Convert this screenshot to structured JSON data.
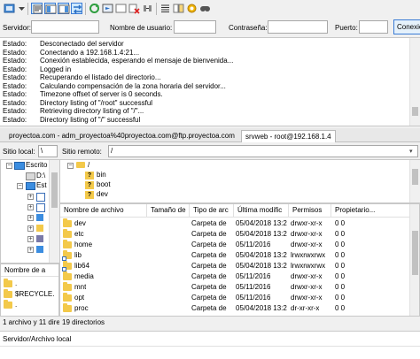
{
  "quickconnect": {
    "host_label": "Servidor:",
    "user_label": "Nombre de usuario:",
    "pass_label": "Contraseña:",
    "port_label": "Puerto:",
    "connect_label": "Conexión rápida",
    "host_value": "",
    "user_value": "",
    "pass_value": "",
    "port_value": ""
  },
  "log": [
    {
      "k": "Estado:",
      "v": "Desconectado del servidor"
    },
    {
      "k": "Estado:",
      "v": "Conectando a 192.168.1.4:21..."
    },
    {
      "k": "Estado:",
      "v": "Conexión establecida, esperando el mensaje de bienvenida..."
    },
    {
      "k": "Estado:",
      "v": "Logged in"
    },
    {
      "k": "Estado:",
      "v": "Recuperando el listado del directorio..."
    },
    {
      "k": "Estado:",
      "v": "Calculando compensación de la zona horaria del servidor..."
    },
    {
      "k": "Estado:",
      "v": "Timezone offset of server is 0 seconds."
    },
    {
      "k": "Estado:",
      "v": "Directory listing of \"/root\" successful"
    },
    {
      "k": "Estado:",
      "v": "Retrieving directory listing of \"/\"..."
    },
    {
      "k": "Estado:",
      "v": "Directory listing of \"/\" successful"
    }
  ],
  "tabs": [
    {
      "label": "proyectoa.com - adm_proyectoa%40proyectoa.com@ftp.proyectoa.com"
    },
    {
      "label": "srvweb - root@192.168.1.4"
    }
  ],
  "local": {
    "path_label": "Sitio local:",
    "path_value": "\\",
    "tree": [
      {
        "label": "Escrito"
      },
      {
        "label": "D:\\"
      },
      {
        "label": "Est"
      }
    ],
    "list_header": "Nombre de a",
    "list": [
      ".",
      "$RECYCLE.",
      "."
    ],
    "status": "1 archivo y 11 dire"
  },
  "remote": {
    "path_label": "Sitio remoto:",
    "path_value": "/",
    "tree": [
      {
        "label": "/"
      },
      {
        "label": "bin"
      },
      {
        "label": "boot"
      },
      {
        "label": "dev"
      }
    ],
    "headers": [
      "Nombre de archivo",
      "Tamaño de",
      "Tipo de arc",
      "Última modific",
      "Permisos",
      "Propietario..."
    ],
    "rows": [
      {
        "name": "dev",
        "size": "",
        "type": "Carpeta de",
        "modified": "05/04/2018 13:2",
        "perms": "drwxr-xr-x",
        "owner": "0 0"
      },
      {
        "name": "etc",
        "size": "",
        "type": "Carpeta de",
        "modified": "05/04/2018 13:2",
        "perms": "drwxr-xr-x",
        "owner": "0 0"
      },
      {
        "name": "home",
        "size": "",
        "type": "Carpeta de",
        "modified": "05/11/2016",
        "perms": "drwxr-xr-x",
        "owner": "0 0"
      },
      {
        "name": "lib",
        "size": "",
        "type": "Carpeta de",
        "modified": "05/04/2018 13:2",
        "perms": "lrwxrwxrwx",
        "owner": "0 0"
      },
      {
        "name": "lib64",
        "size": "",
        "type": "Carpeta de",
        "modified": "05/04/2018 13:2",
        "perms": "lrwxrwxrwx",
        "owner": "0 0"
      },
      {
        "name": "media",
        "size": "",
        "type": "Carpeta de",
        "modified": "05/11/2016",
        "perms": "drwxr-xr-x",
        "owner": "0 0"
      },
      {
        "name": "mnt",
        "size": "",
        "type": "Carpeta de",
        "modified": "05/11/2016",
        "perms": "drwxr-xr-x",
        "owner": "0 0"
      },
      {
        "name": "opt",
        "size": "",
        "type": "Carpeta de",
        "modified": "05/11/2016",
        "perms": "drwxr-xr-x",
        "owner": "0 0"
      },
      {
        "name": "proc",
        "size": "",
        "type": "Carpeta de",
        "modified": "05/04/2018 13:2",
        "perms": "dr-xr-xr-x",
        "owner": "0 0"
      }
    ],
    "status": "19 directorios"
  },
  "queue": {
    "header": "Servidor/Archivo local"
  },
  "colors": {
    "accent": "#3a7bd5",
    "folder": "#f3c94a",
    "selection": "#cce8ff"
  },
  "toolbar_icons": [
    "site-manager-icon",
    "toggle-log-icon",
    "toggle-local-tree-icon",
    "toggle-remote-tree-icon",
    "toggle-queue-icon",
    "refresh-icon",
    "process-queue-icon",
    "cancel-icon",
    "disconnect-icon",
    "reconnect-icon",
    "filter-icon",
    "compare-icon",
    "sync-browse-icon",
    "search-icon"
  ]
}
